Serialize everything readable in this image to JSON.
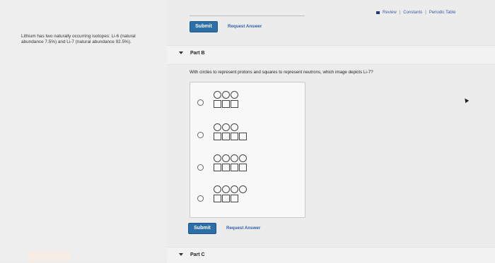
{
  "header": {
    "review_label": "Review",
    "separator": "|",
    "constants_label": "Constants",
    "periodic_label": "Periodic Table"
  },
  "intro": {
    "text": "Lithium has two naturally occurring isotopes: Li-6 (natural abundance 7.5%) and Li-7 (natural abundance 92.5%)."
  },
  "partA_controls": {
    "submit_label": "Submit",
    "request_label": "Request Answer"
  },
  "partB": {
    "title": "Part B",
    "question": "With circles to represent protons and squares to represent neutrons, which image depicts Li-7?",
    "options": [
      {
        "circles": 3,
        "squares": 3
      },
      {
        "circles": 3,
        "squares": 4
      },
      {
        "circles": 4,
        "squares": 4
      },
      {
        "circles": 4,
        "squares": 3
      }
    ],
    "submit_label": "Submit",
    "request_label": "Request Answer"
  },
  "partC": {
    "title": "Part C"
  }
}
